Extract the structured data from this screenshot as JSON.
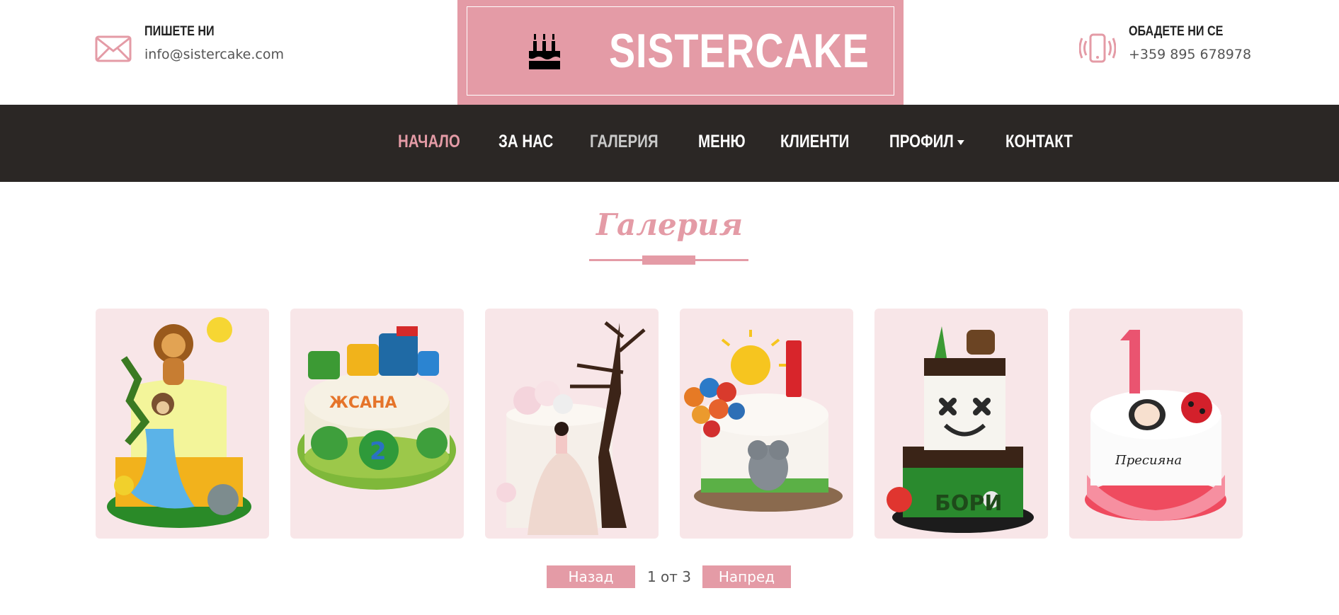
{
  "header": {
    "email": {
      "title": "ПИШЕТЕ НИ",
      "value": "info@sistercake.com"
    },
    "phone": {
      "title": "ОБАДЕТЕ НИ СЕ",
      "value": "+359 895 678978"
    },
    "logo": {
      "text": "SISTERCAKE"
    }
  },
  "nav": {
    "items": [
      {
        "label": "НАЧАЛО"
      },
      {
        "label": "ЗА НАС"
      },
      {
        "label": "ГАЛЕРИЯ"
      },
      {
        "label": "МЕНЮ"
      },
      {
        "label": "КЛИЕНТИ"
      },
      {
        "label": "ПРОФИЛ"
      },
      {
        "label": "КОНТАКТ"
      }
    ]
  },
  "gallery": {
    "title": "Галерия",
    "items": [
      {
        "icon": "jungle-cake-image"
      },
      {
        "icon": "train-cake-image"
      },
      {
        "icon": "princess-tree-cake-image"
      },
      {
        "icon": "balloon-elephant-cake-image"
      },
      {
        "icon": "green-drip-cake-image"
      },
      {
        "icon": "ladybug-cake-image"
      }
    ]
  },
  "pagination": {
    "prev": "Назад",
    "info": "1 от 3",
    "next": "Напред"
  },
  "colors": {
    "accent": "#e49ba6",
    "nav_bg": "#2b2725",
    "card_bg": "#f8e6e8"
  }
}
